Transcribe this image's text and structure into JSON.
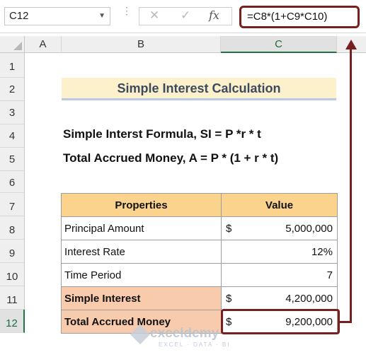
{
  "formula_bar": {
    "name_box": "C12",
    "cancel_icon": "✕",
    "enter_icon": "✓",
    "fx_label": "fx",
    "formula": "=C8*(1+C9*C10)"
  },
  "columns": [
    "A",
    "B",
    "C"
  ],
  "rows": [
    "1",
    "2",
    "3",
    "4",
    "5",
    "6",
    "7",
    "8",
    "9",
    "10",
    "11",
    "12"
  ],
  "sheet": {
    "title": "Simple Interest Calculation",
    "formula_si": "Simple Interst Formula, SI = P *r * t",
    "formula_a": "Total Accrued Money, A = P * (1 + r * t)",
    "table": {
      "header_property": "Properties",
      "header_value": "Value",
      "rows": [
        {
          "label": "Principal Amount",
          "currency": "$",
          "value": "5,000,000"
        },
        {
          "label": "Interest Rate",
          "currency": "",
          "value": "12%"
        },
        {
          "label": "Time Period",
          "currency": "",
          "value": "7"
        },
        {
          "label": "Simple Interest",
          "currency": "$",
          "value": "4,200,000"
        },
        {
          "label": "Total Accrued Money",
          "currency": "$",
          "value": "9,200,000"
        }
      ]
    }
  },
  "watermark": {
    "name": "exceldemy",
    "tagline": "EXCEL · DATA · BI"
  },
  "colors": {
    "accent": "#7a1f1f",
    "title_fill": "#fdf1cc",
    "header_fill": "#fcd38d",
    "highlight_fill": "#f8cbad",
    "selection": "#217346"
  }
}
